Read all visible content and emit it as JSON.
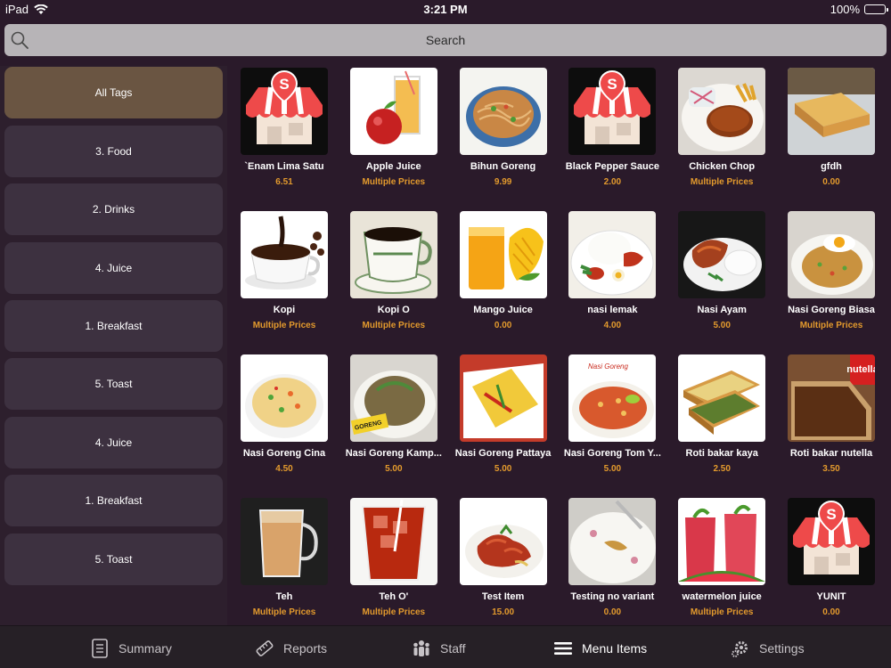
{
  "status_bar": {
    "device": "iPad",
    "time": "3:21 PM",
    "battery": "100%"
  },
  "search": {
    "placeholder": "Search"
  },
  "sidebar": {
    "tags": [
      {
        "label": "All Tags",
        "active": true
      },
      {
        "label": "3. Food"
      },
      {
        "label": "2. Drinks"
      },
      {
        "label": "4. Juice"
      },
      {
        "label": "1. Breakfast"
      },
      {
        "label": "5. Toast"
      },
      {
        "label": "4. Juice"
      },
      {
        "label": "1. Breakfast"
      },
      {
        "label": "5. Toast"
      }
    ]
  },
  "menu": {
    "items": [
      {
        "name": "`Enam Lima Satu",
        "price": "6.51",
        "icon": "store-logo-image"
      },
      {
        "name": "Apple Juice",
        "price": "Multiple Prices",
        "icon": "apple-juice-image"
      },
      {
        "name": "Bihun Goreng",
        "price": "9.99",
        "icon": "noodles-image"
      },
      {
        "name": "Black Pepper Sauce",
        "price": "2.00",
        "icon": "store-logo-image"
      },
      {
        "name": "Chicken Chop",
        "price": "Multiple Prices",
        "icon": "chicken-chop-image"
      },
      {
        "name": "gfdh",
        "price": "0.00",
        "icon": "toast-image"
      },
      {
        "name": "Kopi",
        "price": "Multiple Prices",
        "icon": "coffee-image"
      },
      {
        "name": "Kopi O",
        "price": "Multiple Prices",
        "icon": "coffee-cup-image"
      },
      {
        "name": "Mango Juice",
        "price": "0.00",
        "icon": "mango-juice-image"
      },
      {
        "name": "nasi lemak",
        "price": "4.00",
        "icon": "nasi-lemak-image"
      },
      {
        "name": "Nasi Ayam",
        "price": "5.00",
        "icon": "chicken-rice-image"
      },
      {
        "name": "Nasi Goreng Biasa",
        "price": "Multiple Prices",
        "icon": "fried-rice-egg-image"
      },
      {
        "name": "Nasi Goreng Cina",
        "price": "4.50",
        "icon": "fried-rice-image"
      },
      {
        "name": "Nasi Goreng Kamp...",
        "price": "5.00",
        "icon": "fried-rice-kampung-image"
      },
      {
        "name": "Nasi Goreng Pattaya",
        "price": "5.00",
        "icon": "omelette-rice-image"
      },
      {
        "name": "Nasi Goreng Tom Y...",
        "price": "5.00",
        "icon": "tom-yam-rice-image"
      },
      {
        "name": "Roti bakar kaya",
        "price": "2.50",
        "icon": "kaya-toast-image"
      },
      {
        "name": "Roti bakar nutella",
        "price": "3.50",
        "icon": "nutella-toast-image"
      },
      {
        "name": "Teh",
        "price": "Multiple Prices",
        "icon": "milk-tea-image"
      },
      {
        "name": "Teh O'",
        "price": "Multiple Prices",
        "icon": "iced-tea-image"
      },
      {
        "name": "Test Item",
        "price": "15.00",
        "icon": "chicken-curry-image"
      },
      {
        "name": "Testing no variant",
        "price": "0.00",
        "icon": "empty-plate-image"
      },
      {
        "name": "watermelon juice",
        "price": "Multiple Prices",
        "icon": "watermelon-juice-image"
      },
      {
        "name": "YUNIT",
        "price": "0.00",
        "icon": "store-logo-image"
      }
    ]
  },
  "bottom_nav": {
    "items": [
      {
        "label": "Summary",
        "icon": "summary-icon"
      },
      {
        "label": "Reports",
        "icon": "reports-icon"
      },
      {
        "label": "Staff",
        "icon": "staff-icon"
      },
      {
        "label": "Menu Items",
        "icon": "menu-list-icon",
        "active": true
      },
      {
        "label": "Settings",
        "icon": "gear-icon"
      }
    ]
  },
  "colors": {
    "background": "#2a1a2a",
    "active_tag": "#6a5542",
    "tag": "#3d3140",
    "price": "#e39a2d",
    "search_bar": "#b7b4b7"
  }
}
